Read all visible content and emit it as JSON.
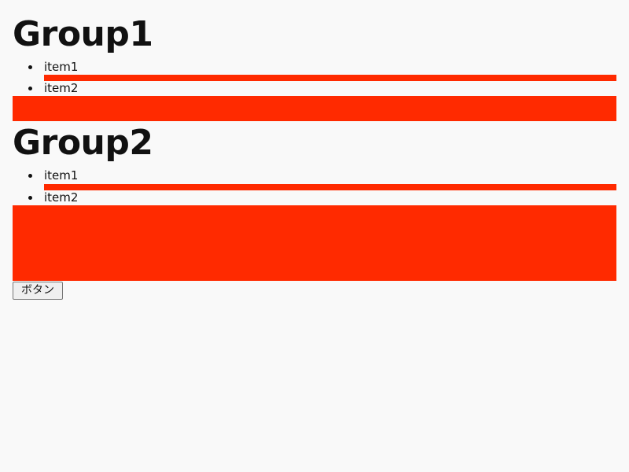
{
  "page": {
    "background": "#f9f9f9",
    "accent": "#ff2a00"
  },
  "groups": [
    {
      "title": "Group1",
      "items": [
        {
          "label": "item1"
        },
        {
          "label": "item2"
        }
      ]
    },
    {
      "title": "Group2",
      "items": [
        {
          "label": "item1"
        },
        {
          "label": "item2"
        }
      ]
    }
  ],
  "button": {
    "label": "ボタン"
  }
}
